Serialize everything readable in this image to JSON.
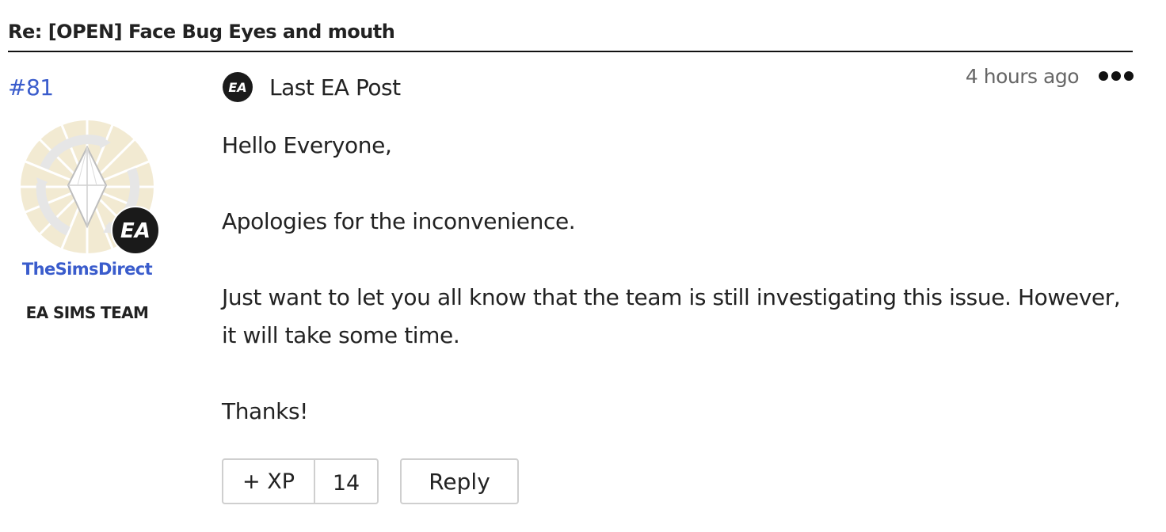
{
  "thread": {
    "title": "Re: [OPEN] Face Bug Eyes and mouth"
  },
  "post": {
    "number": "#81",
    "timestamp": "4 hours ago",
    "last_ea_label": "Last EA Post",
    "author": {
      "username": "TheSimsDirect",
      "role": "EA SIMS TEAM"
    },
    "body": [
      "Hello Everyone,",
      "Apologies for the inconvenience.",
      "Just want to let you all know that the team is still investigating this issue. However, it will take some time.",
      "Thanks!"
    ],
    "actions": {
      "xp_label": "+ XP",
      "xp_count": "14",
      "reply_label": "Reply"
    }
  },
  "icons": {
    "ea_logo": "ea-logo-icon",
    "more": "more-dots-icon",
    "avatar": "plumbob-avatar"
  },
  "colors": {
    "link": "#3a5ccc",
    "badge": "#1a1a1a",
    "avatar_bg": "#f2ead2"
  }
}
